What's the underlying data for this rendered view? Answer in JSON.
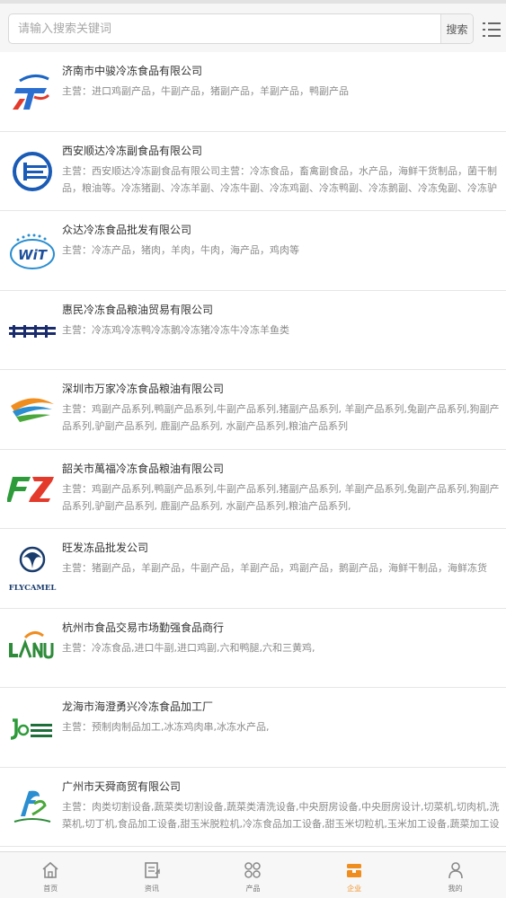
{
  "search": {
    "placeholder": "请输入搜索关键词",
    "button_label": "搜索"
  },
  "colors": {
    "accent": "#f08d1f",
    "text": "#333333",
    "subtext": "#8a8a8a",
    "divider": "#e6e6e6"
  },
  "companies": [
    {
      "name": "济南市中骏冷冻食品有限公司",
      "desc": "主营：进口鸡副产品，牛副产品，猪副产品，羊副产品，鸭副产品",
      "logo": "jt-logo-icon"
    },
    {
      "name": "西安顺达冷冻副食品有限公司",
      "desc": "主营：西安顺达冷冻副食品有限公司主营：冷冻食品，畜禽副食品，水产品，海鲜干货制品，菌干制品，粮油等。冷冻猪副、冷冻羊副、冷冻牛副、冷冻鸡副、冷冻鸭副、冷冻鹅副、冷冻兔副、冷冻驴副、冷...",
      "logo": "sd-logo-icon"
    },
    {
      "name": "众达冷冻食品批发有限公司",
      "desc": "主营：冷冻产品，猪肉，羊肉，牛肉，海产品，鸡肉等",
      "logo": "wit-logo-icon"
    },
    {
      "name": "惠民冷冻食品粮油贸易有限公司",
      "desc": "主营：冷冻鸡冷冻鸭冷冻鹅冷冻猪冷冻牛冷冻羊鱼类",
      "logo": "toyozak-logo-icon"
    },
    {
      "name": "深圳市万家冷冻食品粮油有限公司",
      "desc": "主营：鸡副产品系列,鸭副产品系列,牛副产品系列,猪副产品系列, 羊副产品系列,兔副产品系列,狗副产品系列,驴副产品系列, 鹿副产品系列, 水副产品系列,粮油产品系列",
      "logo": "wanjia-logo-icon"
    },
    {
      "name": "韶关市萬福冷冻食品粮油有限公司",
      "desc": "主营：鸡副产品系列,鸭副产品系列,牛副产品系列,猪副产品系列, 羊副产品系列,兔副产品系列,狗副产品系列,驴副产品系列, 鹿副产品系列, 水副产品系列,粮油产品系列,",
      "logo": "fz-logo-icon"
    },
    {
      "name": "旺发冻品批发公司",
      "desc": "主营：猪副产品，羊副产品，牛副产品，羊副产品，鸡副产品，鹅副产品，海鲜干制品，海鲜冻货",
      "logo": "flycamel-logo-icon",
      "logo_text": "FLYCAMEL"
    },
    {
      "name": "杭州市食品交易市场勤强食品商行",
      "desc": "主营：冷冻食品,进口牛副,进口鸡副,六和鸭腿,六和三黄鸡,",
      "logo": "langjun-logo-icon"
    },
    {
      "name": "龙海市海澄勇兴冷冻食品加工厂",
      "desc": "主营：预制肉制品加工,冰冻鸡肉串,冰冻水产品,",
      "logo": "joheng-logo-icon"
    },
    {
      "name": "广州市天舜商贸有限公司",
      "desc": "主营：肉类切割设备,蔬菜类切割设备,蔬菜类清洗设备,中央厨房设备,中央厨房设计,切菜机,切肉机,洗菜机,切丁机,食品加工设备,甜玉米脱粒机,冷冻食品加工设备,甜玉米切粒机,玉米加工设备,蔬菜加工设备,肉类...",
      "logo": "santa-logo-icon"
    }
  ],
  "tabs": [
    {
      "label": "首页",
      "icon": "home-icon",
      "active": false
    },
    {
      "label": "资讯",
      "icon": "news-icon",
      "active": false
    },
    {
      "label": "产品",
      "icon": "grid-icon",
      "active": false
    },
    {
      "label": "企业",
      "icon": "building-icon",
      "active": true
    },
    {
      "label": "我的",
      "icon": "user-icon",
      "active": false
    }
  ]
}
